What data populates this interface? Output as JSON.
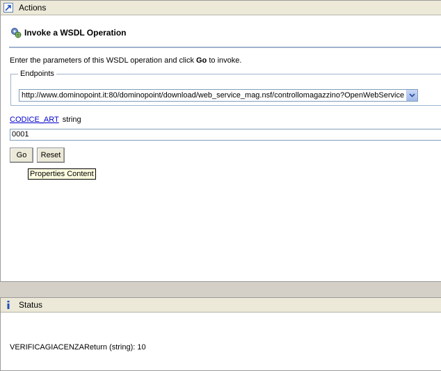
{
  "actions": {
    "header_title": "Actions",
    "header_icon": "arrow-link-icon",
    "operation_title": "Invoke a WSDL Operation",
    "operation_icon": "gear-globe-icon",
    "intro_prefix": "Enter the parameters of this WSDL operation and click ",
    "intro_bold": "Go",
    "intro_suffix": " to invoke.",
    "endpoints_legend": "Endpoints",
    "endpoint_selected": "http://www.dominopoint.it:80/dominopoint/download/web_service_mag.nsf/controllomagazzino?OpenWebService",
    "param_name": "CODICE_ART",
    "param_type": "string",
    "param_value": "0001",
    "go_label": "Go",
    "reset_label": "Reset",
    "tooltip": "Properties Content"
  },
  "status": {
    "header_title": "Status",
    "header_icon": "info-icon",
    "result_text": "VERIFICAGIACENZAReturn (string):  10"
  },
  "colors": {
    "header_bg": "#ece9d8",
    "link": "#0000cc",
    "rule": "#9fb3cf",
    "tooltip_bg": "#ffffe1",
    "info": "#1f4fbf"
  }
}
